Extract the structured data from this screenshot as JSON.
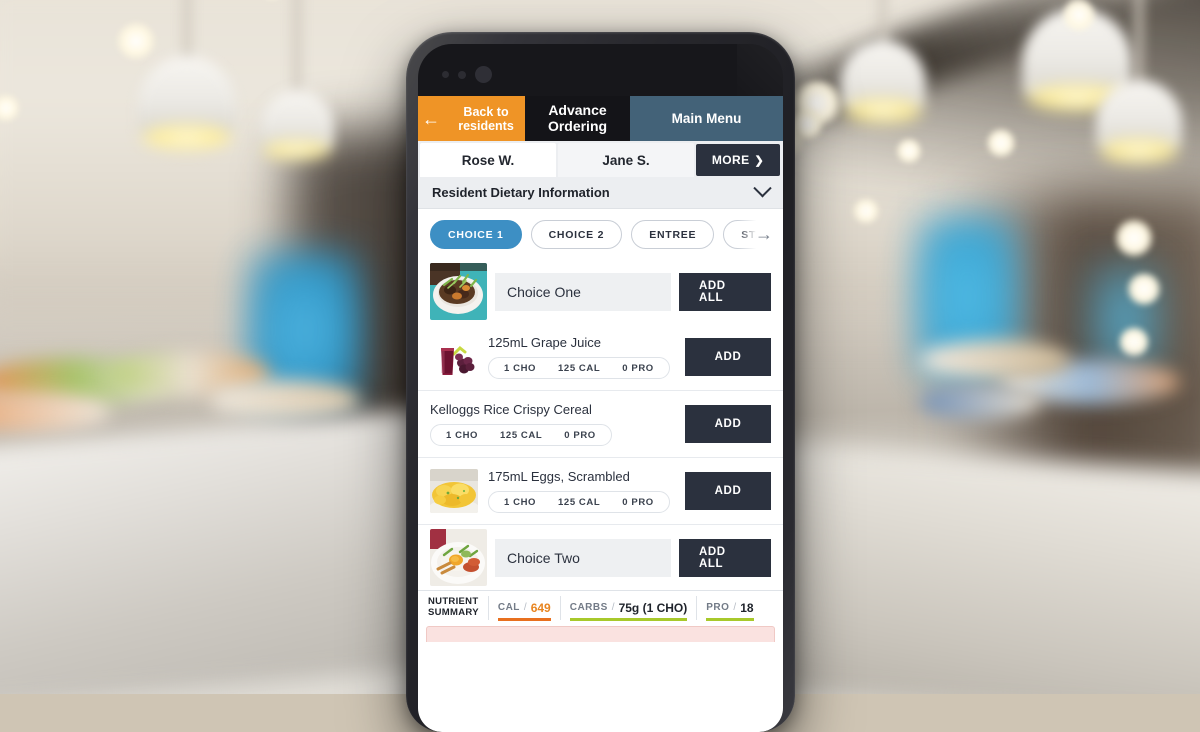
{
  "app": {
    "topnav": {
      "back_label": "Back to residents",
      "back_icon": "arrow-left-icon",
      "title": "Advance Ordering",
      "main_menu_label": "Main Menu",
      "colors": {
        "back": "#ef9426",
        "title": "#141418",
        "menu": "#436278"
      }
    },
    "residents": {
      "tabs": [
        {
          "label": "Rose W.",
          "active": true
        },
        {
          "label": "Jane S.",
          "active": false
        }
      ],
      "more_label": "MORE",
      "more_icon": "chevron-right-icon"
    },
    "dietary": {
      "label": "Resident Dietary Information",
      "toggle_icon": "chevron-down-icon"
    },
    "chips": {
      "items": [
        {
          "label": "CHOICE 1",
          "active": true
        },
        {
          "label": "CHOICE 2",
          "active": false
        },
        {
          "label": "ENTREE",
          "active": false
        },
        {
          "label": "STA",
          "active": false
        }
      ],
      "next_icon": "arrow-right-icon",
      "active_color": "#3d8fc4"
    },
    "sections": [
      {
        "title": "Choice One",
        "add_all_label": "ADD ALL",
        "thumb": "bowl-of-food-thumbnail"
      },
      {
        "title": "Choice Two",
        "add_all_label": "ADD ALL",
        "thumb": "egg-breakfast-plate-thumbnail"
      }
    ],
    "items": [
      {
        "name": "125mL Grape Juice",
        "thumb": "grape-juice-thumbnail",
        "has_thumb": true,
        "macros": [
          "1 CHO",
          "125 CAL",
          "0 PRO"
        ],
        "add_label": "ADD"
      },
      {
        "name": "Kelloggs Rice Crispy Cereal",
        "thumb": "",
        "has_thumb": false,
        "macros": [
          "1 CHO",
          "125 CAL",
          "0 PRO"
        ],
        "add_label": "ADD"
      },
      {
        "name": "175mL Eggs, Scrambled",
        "thumb": "scrambled-eggs-thumbnail",
        "has_thumb": true,
        "macros": [
          "1 CHO",
          "125 CAL",
          "0 PRO"
        ],
        "add_label": "ADD"
      }
    ],
    "nutrient_summary": {
      "title_line1": "NUTRIENT",
      "title_line2": "SUMMARY",
      "stats": [
        {
          "key": "CAL",
          "sep": "/",
          "value": "649",
          "value_color": "#e8841f",
          "underline_color": "#e8701f"
        },
        {
          "key": "CARBS",
          "sep": "/",
          "value": "75g (1 CHO)",
          "value_color": "#1f232b",
          "underline_color": "#a8c92b"
        },
        {
          "key": "PRO",
          "sep": "/",
          "value": "18",
          "value_color": "#1f232b",
          "underline_color": "#a8c92b"
        }
      ]
    }
  }
}
